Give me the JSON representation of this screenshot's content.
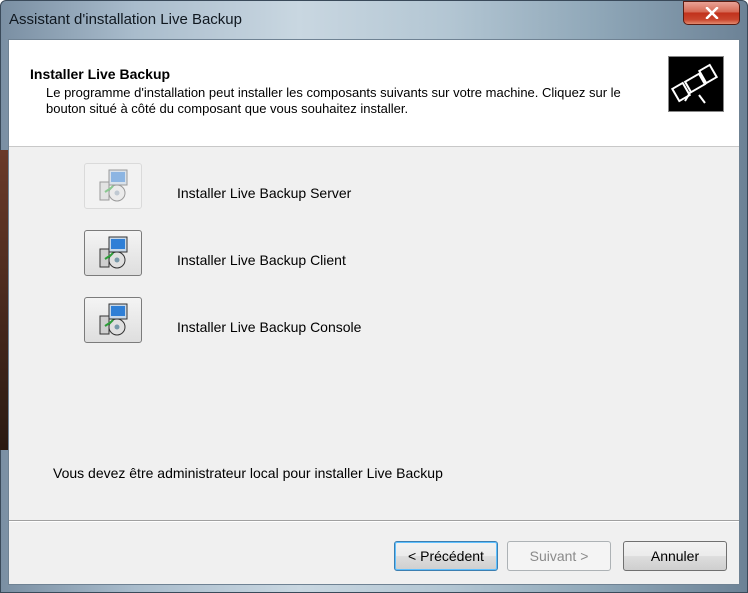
{
  "window": {
    "title": "Assistant d'installation Live Backup",
    "close_label": "X"
  },
  "header": {
    "title": "Installer Live Backup",
    "description": "Le programme d'installation peut installer les composants suivants sur votre machine. Cliquez sur le bouton situé à côté du composant que vous souhaitez installer.",
    "logo_icon": "satellite-icon"
  },
  "components": [
    {
      "label": "Installer Live Backup Server",
      "icon": "setup-icon",
      "enabled": false
    },
    {
      "label": "Installer Live Backup Client",
      "icon": "setup-icon",
      "enabled": true
    },
    {
      "label": "Installer Live Backup Console",
      "icon": "setup-icon",
      "enabled": true
    }
  ],
  "note": "Vous devez être administrateur local pour installer Live Backup",
  "buttons": {
    "back": "< Précédent",
    "next": "Suivant >",
    "cancel": "Annuler"
  },
  "colors": {
    "close_button": "#c9452d",
    "client_bg": "#f0f0f0",
    "default_button_border": "#3c7fb1"
  }
}
